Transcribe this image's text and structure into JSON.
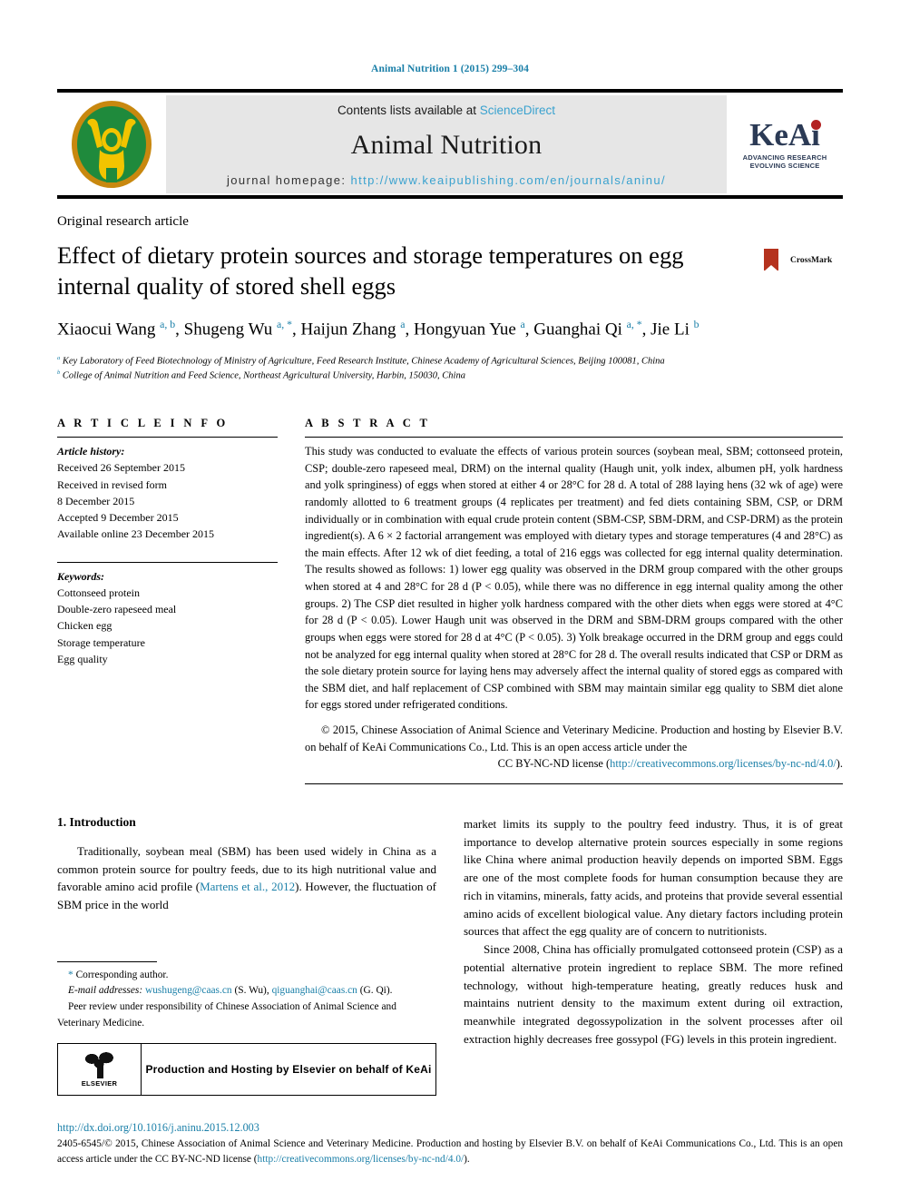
{
  "running_head": "Animal Nutrition 1 (2015) 299–304",
  "banner": {
    "contents_prefix": "Contents lists available at ",
    "contents_link": "ScienceDirect",
    "journal_name": "Animal Nutrition",
    "homepage_label": "journal homepage: ",
    "homepage_url": "http://www.keaipublishing.com/en/journals/aninu/",
    "keai_word": "KeAi",
    "keai_tagline_line1": "ADVANCING RESEARCH",
    "keai_tagline_line2": "EVOLVING SCIENCE",
    "logo_colors": {
      "ring": "#c8880f",
      "disc": "#1f8a3c",
      "figure": "#f2c400"
    }
  },
  "article": {
    "type": "Original research article",
    "title": "Effect of dietary protein sources and storage temperatures on egg internal quality of stored shell eggs",
    "crossmark_label": "CrossMark",
    "authors_html": "Xiaocui Wang <sup>a, b</sup>, Shugeng Wu <sup>a, *</sup>, Haijun Zhang <sup>a</sup>, Hongyuan Yue <sup>a</sup>, Guanghai Qi <sup>a, *</sup>, Jie Li <sup>b</sup>",
    "affiliation_a": "Key Laboratory of Feed Biotechnology of Ministry of Agriculture, Feed Research Institute, Chinese Academy of Agricultural Sciences, Beijing 100081, China",
    "affiliation_b": "College of Animal Nutrition and Feed Science, Northeast Agricultural University, Harbin, 150030, China"
  },
  "info": {
    "heading": "A R T I C L E   I N F O",
    "history_label": "Article history:",
    "history": [
      "Received 26 September 2015",
      "Received in revised form",
      "8 December 2015",
      "Accepted 9 December 2015",
      "Available online 23 December 2015"
    ],
    "keywords_label": "Keywords:",
    "keywords": [
      "Cottonseed protein",
      "Double-zero rapeseed meal",
      "Chicken egg",
      "Storage temperature",
      "Egg quality"
    ]
  },
  "abstract": {
    "heading": "A B S T R A C T",
    "body": "This study was conducted to evaluate the effects of various protein sources (soybean meal, SBM; cottonseed protein, CSP; double-zero rapeseed meal, DRM) on the internal quality (Haugh unit, yolk index, albumen pH, yolk hardness and yolk springiness) of eggs when stored at either 4 or 28°C for 28 d. A total of 288 laying hens (32 wk of age) were randomly allotted to 6 treatment groups (4 replicates per treatment) and fed diets containing SBM, CSP, or DRM individually or in combination with equal crude protein content (SBM-CSP, SBM-DRM, and CSP-DRM) as the protein ingredient(s). A 6 × 2 factorial arrangement was employed with dietary types and storage temperatures (4 and 28°C) as the main effects. After 12 wk of diet feeding, a total of 216 eggs was collected for egg internal quality determination. The results showed as follows: 1) lower egg quality was observed in the DRM group compared with the other groups when stored at 4 and 28°C for 28 d (P < 0.05), while there was no difference in egg internal quality among the other groups. 2) The CSP diet resulted in higher yolk hardness compared with the other diets when eggs were stored at 4°C for 28 d (P < 0.05). Lower Haugh unit was observed in the DRM and SBM-DRM groups compared with the other groups when eggs were stored for 28 d at 4°C (P < 0.05). 3) Yolk breakage occurred in the DRM group and eggs could not be analyzed for egg internal quality when stored at 28°C for 28 d. The overall results indicated that CSP or DRM as the sole dietary protein source for laying hens may adversely affect the internal quality of stored eggs as compared with the SBM diet, and half replacement of CSP combined with SBM may maintain similar egg quality to SBM diet alone for eggs stored under refrigerated conditions.",
    "copyright_text": "© 2015, Chinese Association of Animal Science and Veterinary Medicine. Production and hosting by Elsevier B.V. on behalf of KeAi Communications Co., Ltd. This is an open access article under the",
    "license_prefix": "CC BY-NC-ND license (",
    "license_link": "http://creativecommons.org/licenses/by-nc-nd/4.0/",
    "license_suffix": ")."
  },
  "introduction": {
    "heading": "1.  Introduction",
    "para1_pre": "Traditionally, soybean meal (SBM) has been used widely in China as a common protein source for poultry feeds, due to its high nutritional value and favorable amino acid profile (",
    "para1_cite": "Martens et al., 2012",
    "para1_post": "). However, the fluctuation of SBM price in the world market limits its supply to the poultry feed industry. Thus, it is of great importance to develop alternative protein sources especially in some regions like China where animal production heavily depends on imported SBM. Eggs are one of the most complete foods for human consumption because they are rich in vitamins, minerals, fatty acids, and proteins that provide several essential amino acids of excellent biological value. Any dietary factors including protein sources that affect the egg quality are of concern to nutritionists.",
    "para2": "Since 2008, China has officially promulgated cottonseed protein (CSP) as a potential alternative protein ingredient to replace SBM. The more refined technology, without high-temperature heating, greatly reduces husk and maintains nutrient density to the maximum extent during oil extraction, meanwhile integrated degossypolization in the solvent processes after oil extraction highly decreases free gossypol (FG) levels in this protein ingredient."
  },
  "footnotes": {
    "corresponding": "Corresponding author.",
    "email_label": "E-mail addresses:",
    "email1": "wushugeng@caas.cn",
    "email1_owner": "(S. Wu),",
    "email2": "qiguanghai@caas.cn",
    "email2_owner": "(G. Qi).",
    "peer_review": "Peer review under responsibility of Chinese Association of Animal Science and Veterinary Medicine.",
    "production_box_label": "Production and Hosting by Elsevier on behalf of KeAi",
    "elsevier_word": "ELSEVIER"
  },
  "footer": {
    "doi": "http://dx.doi.org/10.1016/j.aninu.2015.12.003",
    "issn_copyright": "2405-6545/© 2015, Chinese Association of Animal Science and Veterinary Medicine. Production and hosting by Elsevier B.V. on behalf of KeAi Communications Co., Ltd. This is an open access article under the CC BY-NC-ND license (",
    "license_link": "http://creativecommons.org/licenses/by-nc-nd/4.0/",
    "license_suffix": ")."
  }
}
